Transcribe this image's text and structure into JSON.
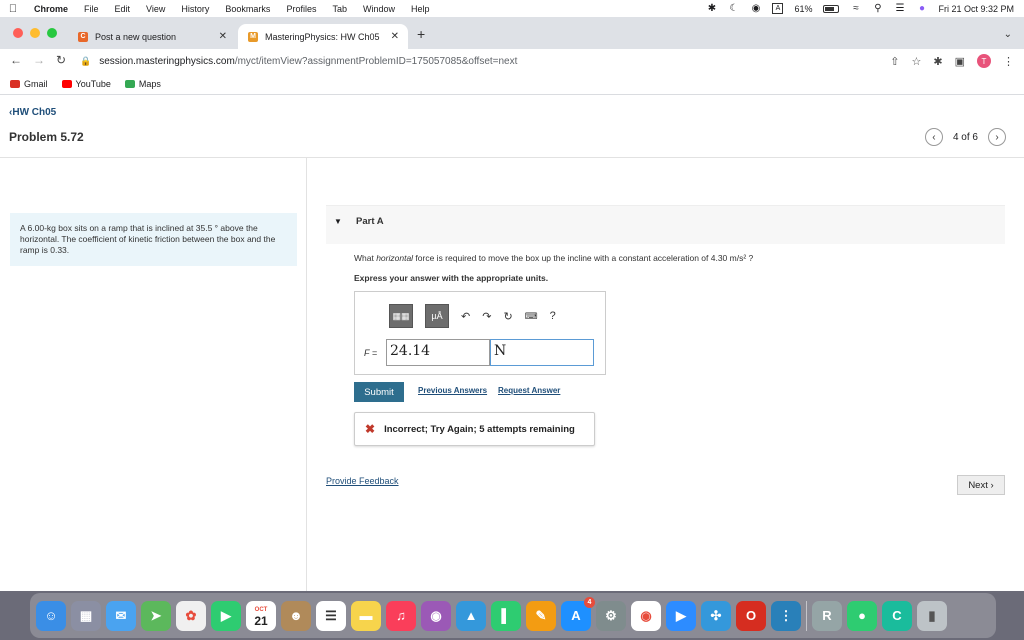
{
  "menubar": {
    "app_name": "Chrome",
    "items": [
      "File",
      "Edit",
      "View",
      "History",
      "Bookmarks",
      "Profiles",
      "Tab",
      "Window",
      "Help"
    ],
    "battery": "61%",
    "datetime": "Fri 21 Oct  9:32 PM"
  },
  "tabs": [
    {
      "title": "Post a new question",
      "favicon": "C",
      "favicon_color": "#e8682a"
    },
    {
      "title": "MasteringPhysics: HW Ch05",
      "favicon": "M",
      "favicon_color": "#e89a2a"
    }
  ],
  "address": {
    "domain": "session.masteringphysics.com",
    "path": "/myct/itemView?assignmentProblemID=175057085&offset=next"
  },
  "bookmarks": [
    {
      "label": "Gmail",
      "color": "#d93025"
    },
    {
      "label": "YouTube",
      "color": "#ff0000"
    },
    {
      "label": "Maps",
      "color": "#34a853"
    }
  ],
  "avatar_letter": "T",
  "page": {
    "back_link": "HW Ch05",
    "problem_title": "Problem 5.72",
    "pager": "4 of 6",
    "problem_text": "A 6.00-kg box sits on a ramp that is inclined at 35.5 ° above the horizontal. The coefficient of kinetic friction between the box and the ramp is 0.33.",
    "part_label": "Part A",
    "question_pre": "What ",
    "question_em": "horizontal",
    "question_post": " force is required to move the box up the incline with a constant acceleration of 4.30  m/s² ?",
    "instruction": "Express your answer with the appropriate units.",
    "var_label": "F =",
    "answer_value": "24.14",
    "answer_unit": "N",
    "submit_label": "Submit",
    "prev_answers": "Previous Answers",
    "request_answer": "Request Answer",
    "feedback": "Incorrect; Try Again; 5 attempts remaining",
    "provide_feedback": "Provide Feedback",
    "next_label": "Next"
  },
  "dock": {
    "calendar_month": "OCT",
    "calendar_day": "21",
    "badge": "4"
  }
}
